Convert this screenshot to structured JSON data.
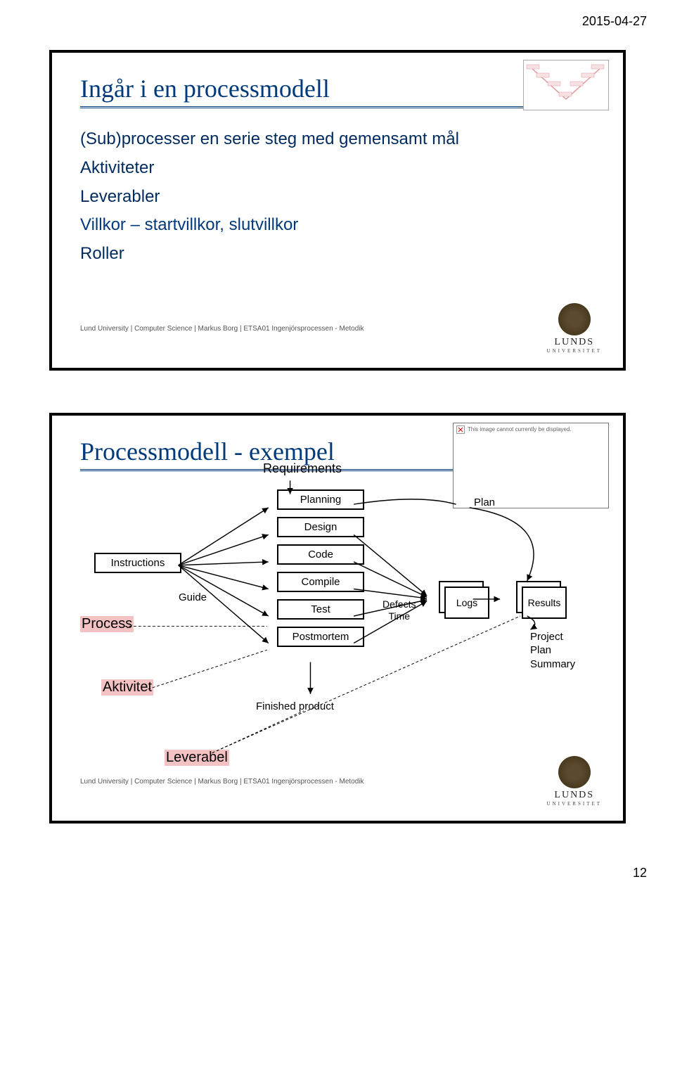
{
  "date": "2015-04-27",
  "slide1": {
    "title": "Ingår i en processmodell",
    "lines": {
      "l1": "(Sub)processer en serie steg med gemensamt mål",
      "l2": "Aktiviteter",
      "l3": "Leverabler",
      "l4": "Villkor – startvillkor, slutvillkor",
      "l5": "Roller"
    },
    "footer": "Lund University | Computer Science | Markus Borg | ETSA01 Ingenjörsprocessen - Metodik",
    "logo": {
      "name": "LUNDS",
      "sub": "UNIVERSITET"
    }
  },
  "slide2": {
    "title": "Processmodell - exempel",
    "thumbErr": "This image cannot currently be displayed.",
    "labels": {
      "requirements": "Requirements",
      "planning": "Planning",
      "design": "Design",
      "code": "Code",
      "compile": "Compile",
      "test": "Test",
      "postmortem": "Postmortem",
      "instructions": "Instructions",
      "guide": "Guide",
      "finished": "Finished product",
      "defects": "Defects",
      "time": "Time",
      "plan": "Plan",
      "logs": "Logs",
      "results": "Results",
      "project": "Project",
      "planS": "Plan",
      "summaryS": "Summary",
      "process": "Process",
      "aktivitet": "Aktivitet",
      "leverabel": "Leverabel"
    },
    "footer": "Lund University | Computer Science | Markus Borg | ETSA01 Ingenjörsprocessen - Metodik",
    "logo": {
      "name": "LUNDS",
      "sub": "UNIVERSITET"
    }
  },
  "pageNumber": "12"
}
